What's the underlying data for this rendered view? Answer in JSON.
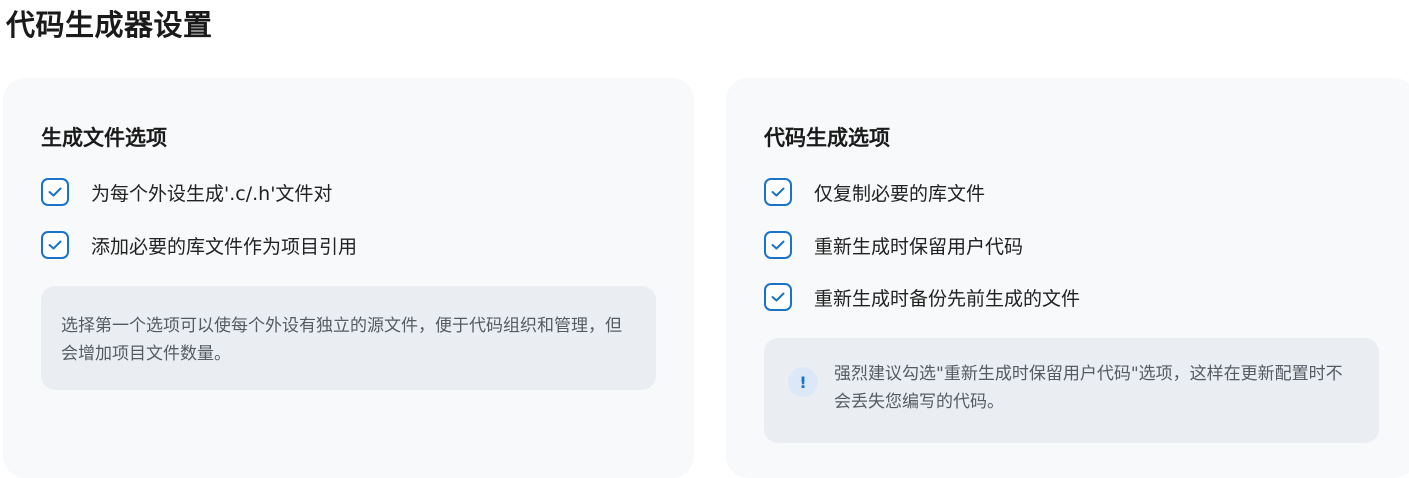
{
  "page": {
    "title": "代码生成器设置"
  },
  "file_options": {
    "title": "生成文件选项",
    "options": [
      {
        "label": "为每个外设生成'.c/.h'文件对",
        "checked": true
      },
      {
        "label": "添加必要的库文件作为项目引用",
        "checked": true
      }
    ],
    "note": "选择第一个选项可以使每个外设有独立的源文件，便于代码组织和管理，但会增加项目文件数量。"
  },
  "codegen_options": {
    "title": "代码生成选项",
    "options": [
      {
        "label": "仅复制必要的库文件",
        "checked": true
      },
      {
        "label": "重新生成时保留用户代码",
        "checked": true
      },
      {
        "label": "重新生成时备份先前生成的文件",
        "checked": true
      }
    ],
    "warning_icon": "!",
    "warning": "强烈建议勾选\"重新生成时保留用户代码\"选项，这样在更新配置时不会丢失您编写的代码。"
  },
  "colors": {
    "accent": "#1a73c8",
    "card_bg": "#f8f9fa",
    "note_bg": "#eaeef3"
  },
  "icons": {
    "checkbox": "check-icon",
    "warning": "exclamation-icon"
  }
}
